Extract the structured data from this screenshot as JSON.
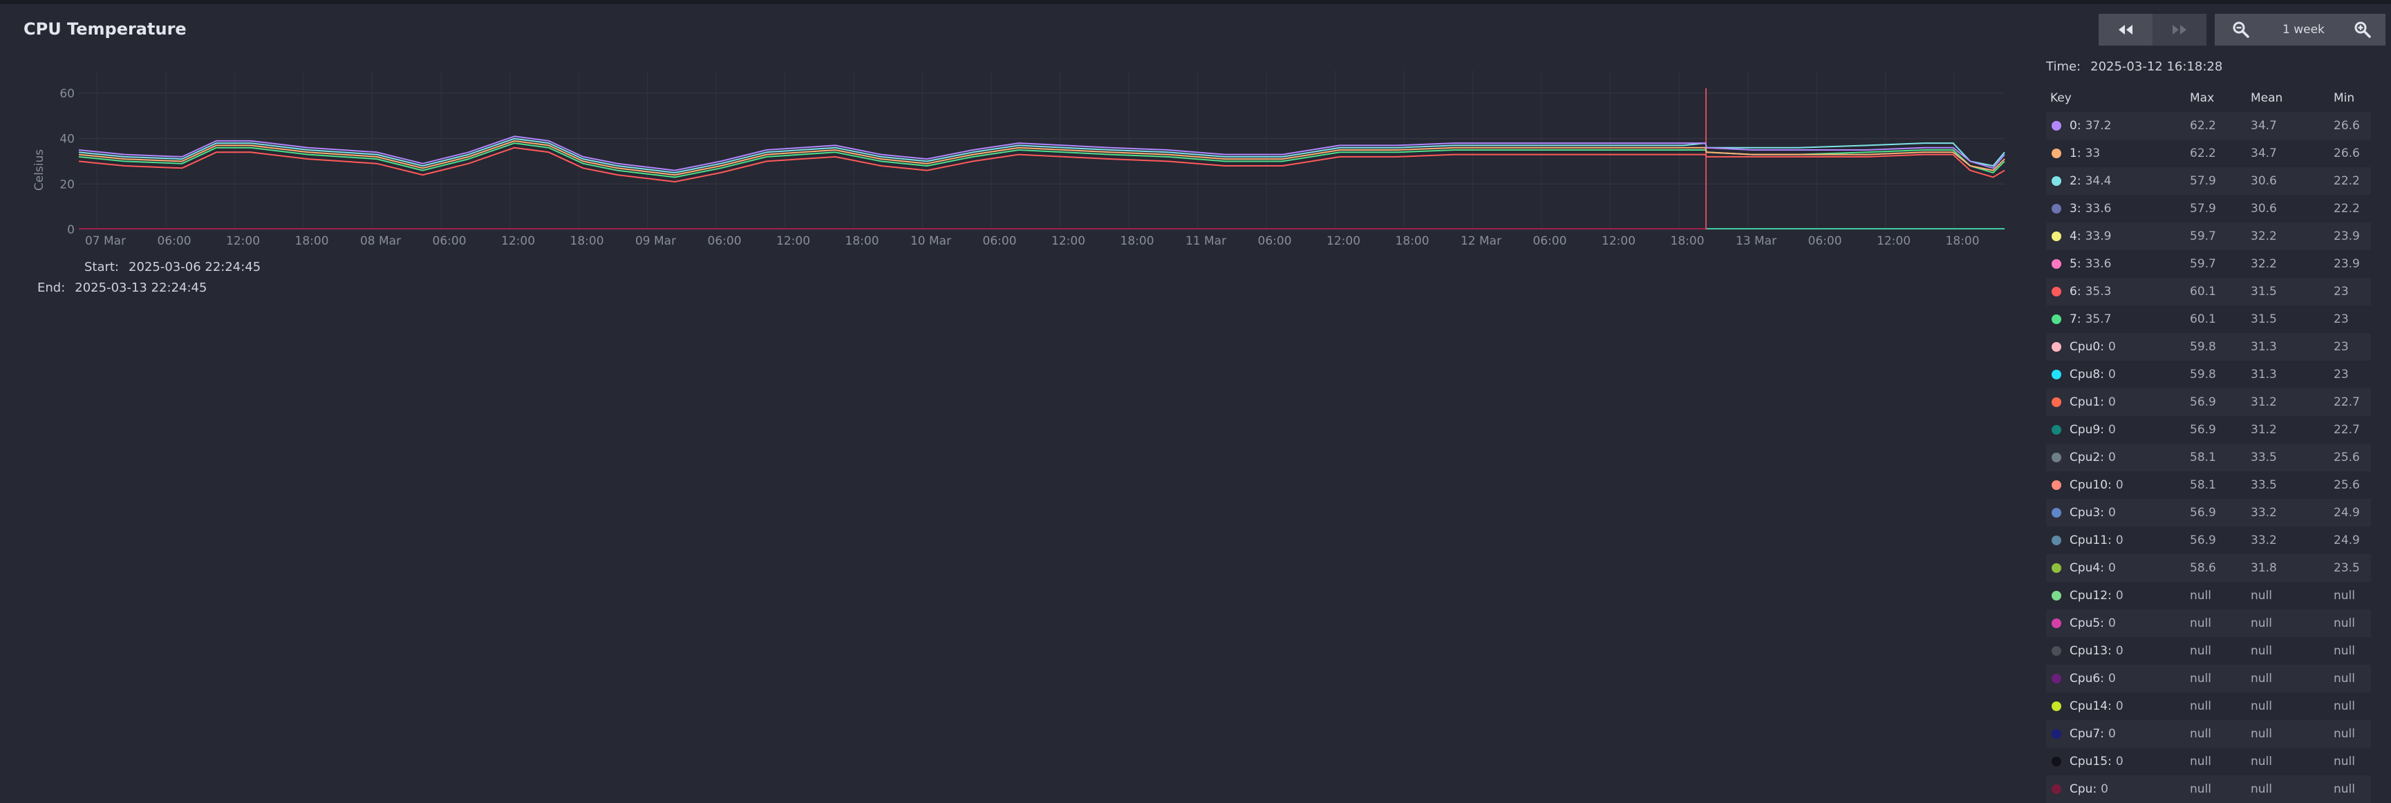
{
  "panel": {
    "title": "CPU Temperature",
    "zoom_label": "1 week"
  },
  "chart_data": {
    "type": "line",
    "ylabel": "Celsius",
    "ylim": [
      0,
      70
    ],
    "yticks": [
      0,
      20,
      40,
      60
    ],
    "xlim": [
      "2025-03-06 22:24:45",
      "2025-03-13 22:24:45"
    ],
    "x_tick_labels": [
      "07 Mar",
      "06:00",
      "12:00",
      "18:00",
      "08 Mar",
      "06:00",
      "12:00",
      "18:00",
      "09 Mar",
      "06:00",
      "12:00",
      "18:00",
      "10 Mar",
      "06:00",
      "12:00",
      "18:00",
      "11 Mar",
      "06:00",
      "12:00",
      "18:00",
      "12 Mar",
      "06:00",
      "12:00",
      "18:00",
      "13 Mar",
      "06:00",
      "12:00",
      "18:00"
    ],
    "x_tick_hours": [
      1.6,
      7.6,
      13.6,
      19.6,
      25.6,
      31.6,
      37.6,
      43.6,
      49.6,
      55.6,
      61.6,
      67.6,
      73.6,
      79.6,
      85.6,
      91.6,
      97.6,
      103.6,
      109.6,
      115.6,
      121.6,
      127.6,
      133.6,
      139.6,
      145.6,
      151.6,
      157.6,
      163.6
    ],
    "x_unit_note": "hours since 2025-03-06 22:24:45",
    "grid": true,
    "legend_position": "right",
    "series_x_hours": [
      0,
      4,
      9,
      12,
      15,
      20,
      26,
      30,
      34,
      38,
      41,
      44,
      47,
      52,
      56,
      60,
      66,
      70,
      74,
      78,
      82,
      86,
      90,
      95,
      100,
      105,
      110,
      115,
      120,
      125,
      130,
      136,
      140,
      141.9,
      142,
      146,
      150,
      156,
      161,
      163.5,
      165,
      167,
      168
    ],
    "series": [
      {
        "name": "0",
        "color": "#b388ff",
        "values": [
          35,
          33,
          32,
          39,
          39,
          36,
          34,
          29,
          34,
          41,
          39,
          32,
          29,
          26,
          30,
          35,
          37,
          33,
          31,
          35,
          38,
          37,
          36,
          35,
          33,
          33,
          37,
          37,
          38,
          38,
          38,
          38,
          38,
          38,
          36,
          35,
          35,
          35,
          36,
          36,
          30,
          27,
          33
        ]
      },
      {
        "name": "1",
        "color": "#ffb074",
        "values": [
          33,
          31,
          30,
          37,
          37,
          34,
          32,
          27,
          32,
          39,
          37,
          30,
          27,
          24,
          28,
          33,
          35,
          31,
          29,
          33,
          36,
          35,
          34,
          33,
          31,
          31,
          35,
          35,
          36,
          36,
          36,
          36,
          36,
          36,
          34,
          33,
          33,
          33,
          34,
          34,
          28,
          26,
          31
        ]
      },
      {
        "name": "2",
        "color": "#7fe3e8",
        "values": [
          34,
          32,
          31,
          38,
          38,
          35,
          33,
          28,
          33,
          40,
          38,
          31,
          28,
          25,
          29,
          34,
          36,
          32,
          30,
          34,
          37,
          36,
          35,
          34,
          32,
          32,
          36,
          36,
          37,
          37,
          37,
          37,
          37,
          38,
          36,
          36,
          36,
          37,
          38,
          38,
          30,
          28,
          34
        ]
      },
      {
        "name": "7",
        "color": "#50e08c",
        "values": [
          32,
          30,
          29,
          36,
          36,
          33,
          31,
          26,
          31,
          38,
          36,
          29,
          26,
          23,
          27,
          32,
          34,
          30,
          28,
          32,
          35,
          34,
          33,
          32,
          30,
          30,
          34,
          34,
          35,
          35,
          35,
          35,
          35,
          35,
          34,
          33,
          33,
          34,
          35,
          35,
          28,
          25,
          30
        ]
      },
      {
        "name": "6",
        "color": "#ff5a5a",
        "values": [
          30,
          28,
          27,
          34,
          34,
          31,
          29,
          24,
          29,
          36,
          34,
          27,
          24,
          21,
          25,
          30,
          32,
          28,
          26,
          30,
          33,
          32,
          31,
          30,
          28,
          28,
          32,
          32,
          33,
          33,
          33,
          33,
          33,
          33,
          32,
          32,
          32,
          32,
          33,
          33,
          26,
          23,
          26
        ]
      }
    ]
  },
  "range": {
    "start_label": "Start:",
    "start": "2025-03-06 22:24:45",
    "end_label": "End:",
    "end": "2025-03-13 22:24:45"
  },
  "legend": {
    "time_label": "Time:",
    "time": "2025-03-12 16:18:28",
    "headers": {
      "key": "Key",
      "max": "Max",
      "mean": "Mean",
      "min": "Min"
    },
    "rows": [
      {
        "key": "0",
        "val": "37.2",
        "color": "#b388ff",
        "max": "62.2",
        "mean": "34.7",
        "min": "26.6"
      },
      {
        "key": "1",
        "val": "33",
        "color": "#ffb074",
        "max": "62.2",
        "mean": "34.7",
        "min": "26.6"
      },
      {
        "key": "2",
        "val": "34.4",
        "color": "#7fe3e8",
        "max": "57.9",
        "mean": "30.6",
        "min": "22.2"
      },
      {
        "key": "3",
        "val": "33.6",
        "color": "#6b73b0",
        "max": "57.9",
        "mean": "30.6",
        "min": "22.2"
      },
      {
        "key": "4",
        "val": "33.9",
        "color": "#f5f07a",
        "max": "59.7",
        "mean": "32.2",
        "min": "23.9"
      },
      {
        "key": "5",
        "val": "33.6",
        "color": "#ff77c1",
        "max": "59.7",
        "mean": "32.2",
        "min": "23.9"
      },
      {
        "key": "6",
        "val": "35.3",
        "color": "#ff5a5a",
        "max": "60.1",
        "mean": "31.5",
        "min": "23"
      },
      {
        "key": "7",
        "val": "35.7",
        "color": "#50e08c",
        "max": "60.1",
        "mean": "31.5",
        "min": "23"
      },
      {
        "key": "Cpu0",
        "val": "0",
        "color": "#ffb6c1",
        "max": "59.8",
        "mean": "31.3",
        "min": "23"
      },
      {
        "key": "Cpu8",
        "val": "0",
        "color": "#22e0ff",
        "max": "59.8",
        "mean": "31.3",
        "min": "23"
      },
      {
        "key": "Cpu1",
        "val": "0",
        "color": "#ff6a4d",
        "max": "56.9",
        "mean": "31.2",
        "min": "22.7"
      },
      {
        "key": "Cpu9",
        "val": "0",
        "color": "#13857d",
        "max": "56.9",
        "mean": "31.2",
        "min": "22.7"
      },
      {
        "key": "Cpu2",
        "val": "0",
        "color": "#6f7f8a",
        "max": "58.1",
        "mean": "33.5",
        "min": "25.6"
      },
      {
        "key": "Cpu10",
        "val": "0",
        "color": "#ff8a7a",
        "max": "58.1",
        "mean": "33.5",
        "min": "25.6"
      },
      {
        "key": "Cpu3",
        "val": "0",
        "color": "#5f86c9",
        "max": "56.9",
        "mean": "33.2",
        "min": "24.9"
      },
      {
        "key": "Cpu11",
        "val": "0",
        "color": "#5c8aa6",
        "max": "56.9",
        "mean": "33.2",
        "min": "24.9"
      },
      {
        "key": "Cpu4",
        "val": "0",
        "color": "#8fc13f",
        "max": "58.6",
        "mean": "31.8",
        "min": "23.5"
      },
      {
        "key": "Cpu12",
        "val": "0",
        "color": "#7ddc8c",
        "max": "null",
        "mean": "null",
        "min": "null"
      },
      {
        "key": "Cpu5",
        "val": "0",
        "color": "#d63fa8",
        "max": "null",
        "mean": "null",
        "min": "null"
      },
      {
        "key": "Cpu13",
        "val": "0",
        "color": "#4c4e58",
        "max": "null",
        "mean": "null",
        "min": "null"
      },
      {
        "key": "Cpu6",
        "val": "0",
        "color": "#6a1f7a",
        "max": "null",
        "mean": "null",
        "min": "null"
      },
      {
        "key": "Cpu14",
        "val": "0",
        "color": "#c8e627",
        "max": "null",
        "mean": "null",
        "min": "null"
      },
      {
        "key": "Cpu7",
        "val": "0",
        "color": "#1a1f7a",
        "max": "null",
        "mean": "null",
        "min": "null"
      },
      {
        "key": "Cpu15",
        "val": "0",
        "color": "#121018",
        "max": "null",
        "mean": "null",
        "min": "null"
      },
      {
        "key": "Cpu",
        "val": "0",
        "color": "#7a1a3a",
        "max": "null",
        "mean": "null",
        "min": "null"
      }
    ]
  }
}
